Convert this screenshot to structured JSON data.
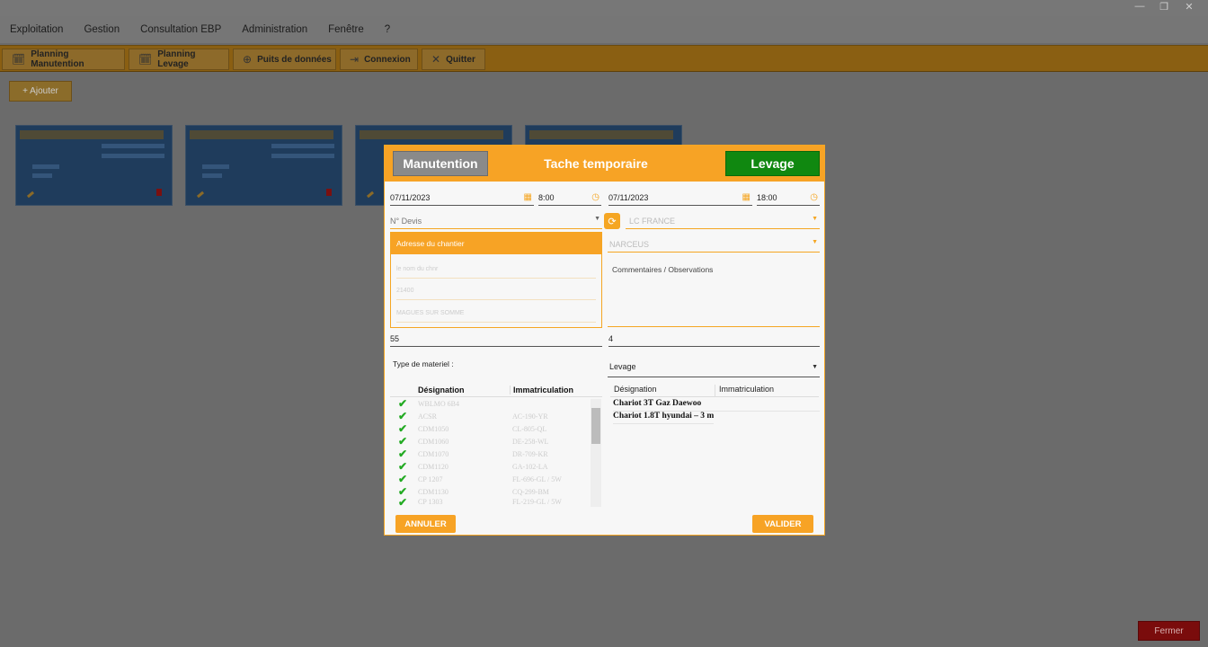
{
  "window": {
    "controls": [
      "—",
      "❐",
      "✕"
    ]
  },
  "menu": [
    "Exploitation",
    "Gestion",
    "Consultation EBP",
    "Administration",
    "Fenêtre",
    "?"
  ],
  "toolbar": [
    {
      "label": "Planning Manutention",
      "icon": "calendar-clock-icon",
      "glyph": "🗓"
    },
    {
      "label": "Planning Levage",
      "icon": "calendar-clock-icon",
      "glyph": "🗓"
    },
    {
      "label": "Puits de données",
      "icon": "globe-icon",
      "glyph": "⊕"
    },
    {
      "label": "Connexion",
      "icon": "login-icon",
      "glyph": "⇥"
    },
    {
      "label": "Quitter",
      "icon": "close-icon",
      "glyph": "✕"
    }
  ],
  "add_button": "+ Ajouter",
  "close_button": "Fermer",
  "dialog": {
    "left_button": "Manutention",
    "title": "Tache temporaire",
    "right_button": "Levage",
    "start_date": "07/11/2023",
    "start_time": "8:00",
    "end_date": "07/11/2023",
    "end_time": "18:00",
    "devis_placeholder": "N° Devis",
    "client_value": "LC FRANCE",
    "contact_value": "NARCEUS",
    "address_header": "Adresse du chantier",
    "address_lines": [
      "le nom du chnr",
      "21400",
      "MAGUES SUR SOMME"
    ],
    "comments_placeholder": "Commentaires / Observations",
    "left_number": "55",
    "right_number": "4",
    "type_label": "Type de materiel :",
    "type_select": "Levage",
    "left_table": {
      "headers": [
        "Désignation",
        "Immatriculation"
      ],
      "rows": [
        {
          "designation": "WBLMO 6B4",
          "immat": ""
        },
        {
          "designation": "ACSR",
          "immat": "AC-190-YR"
        },
        {
          "designation": "CDM1050",
          "immat": "CL-805-QL"
        },
        {
          "designation": "CDM1060",
          "immat": "DE-258-WL"
        },
        {
          "designation": "CDM1070",
          "immat": "DR-709-KR"
        },
        {
          "designation": "CDM1120",
          "immat": "GA-102-LA"
        },
        {
          "designation": "CP 1207",
          "immat": "FL-696-GL / 5W"
        },
        {
          "designation": "CDM1130",
          "immat": "CQ-299-BM"
        },
        {
          "designation": "CP 1303",
          "immat": "FL-219-GL / 5W"
        }
      ]
    },
    "right_table": {
      "headers": [
        "Désignation",
        "Immatriculation"
      ],
      "rows": [
        "Chariot 3T Gaz Daewoo",
        "Chariot 1.8T hyundai – 3 m"
      ]
    },
    "cancel_button": "ANNULER",
    "validate_button": "VALIDER"
  }
}
